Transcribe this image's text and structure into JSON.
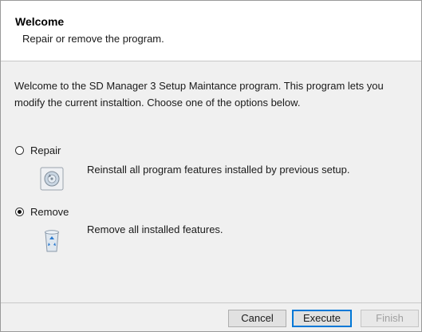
{
  "header": {
    "title": "Welcome",
    "subtitle": "Repair or remove the program."
  },
  "intro_text": "Welcome to the SD Manager 3 Setup Maintance program. This program lets you modify the current instaltion. Choose one of the options below.",
  "options": [
    {
      "label": "Repair",
      "selected": false,
      "icon": "repair-disc-icon",
      "description": "Reinstall all program features installed by previous setup."
    },
    {
      "label": "Remove",
      "selected": true,
      "icon": "recycle-bin-icon",
      "description": "Remove all installed features."
    }
  ],
  "buttons": {
    "cancel": "Cancel",
    "execute": "Execute",
    "finish": "Finish"
  },
  "colors": {
    "accent": "#0078d7",
    "panel": "#f0f0f0",
    "header_bg": "#ffffff"
  }
}
